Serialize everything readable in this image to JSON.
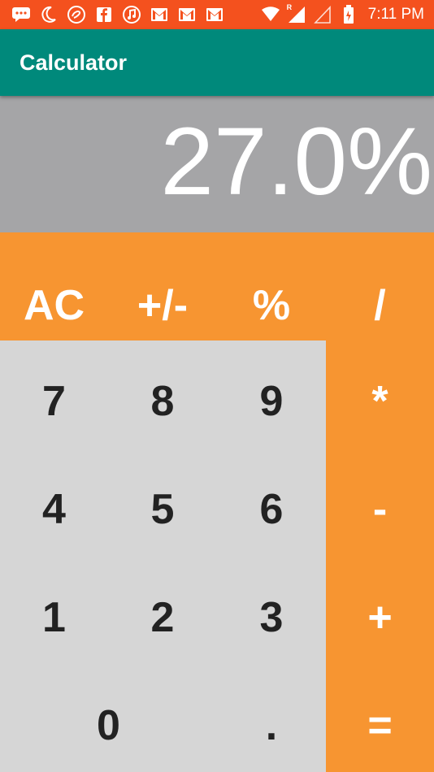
{
  "status_bar": {
    "time": "7:11 PM",
    "signal_letter": "R",
    "icons": [
      "message-icon",
      "moon-icon",
      "airtel-icon",
      "facebook-icon",
      "music-icon",
      "gmail-icon",
      "gmail-icon",
      "gmail-icon",
      "wifi-icon",
      "signal-icon",
      "signal-empty-icon",
      "battery-charging-icon"
    ]
  },
  "app_bar": {
    "title": "Calculator"
  },
  "display": {
    "value": "27.0%"
  },
  "keys": {
    "ac": "AC",
    "sign": "+/-",
    "percent": "%",
    "divide": "/",
    "seven": "7",
    "eight": "8",
    "nine": "9",
    "multiply": "*",
    "four": "4",
    "five": "5",
    "six": "6",
    "minus": "-",
    "one": "1",
    "two": "2",
    "three": "3",
    "plus": "+",
    "zero": "0",
    "dot": ".",
    "equals": "="
  },
  "colors": {
    "status_bar": "#f4511e",
    "app_bar": "#00897b",
    "display": "#a5a5a7",
    "operator": "#f79531",
    "number_pad": "#d6d6d6"
  }
}
